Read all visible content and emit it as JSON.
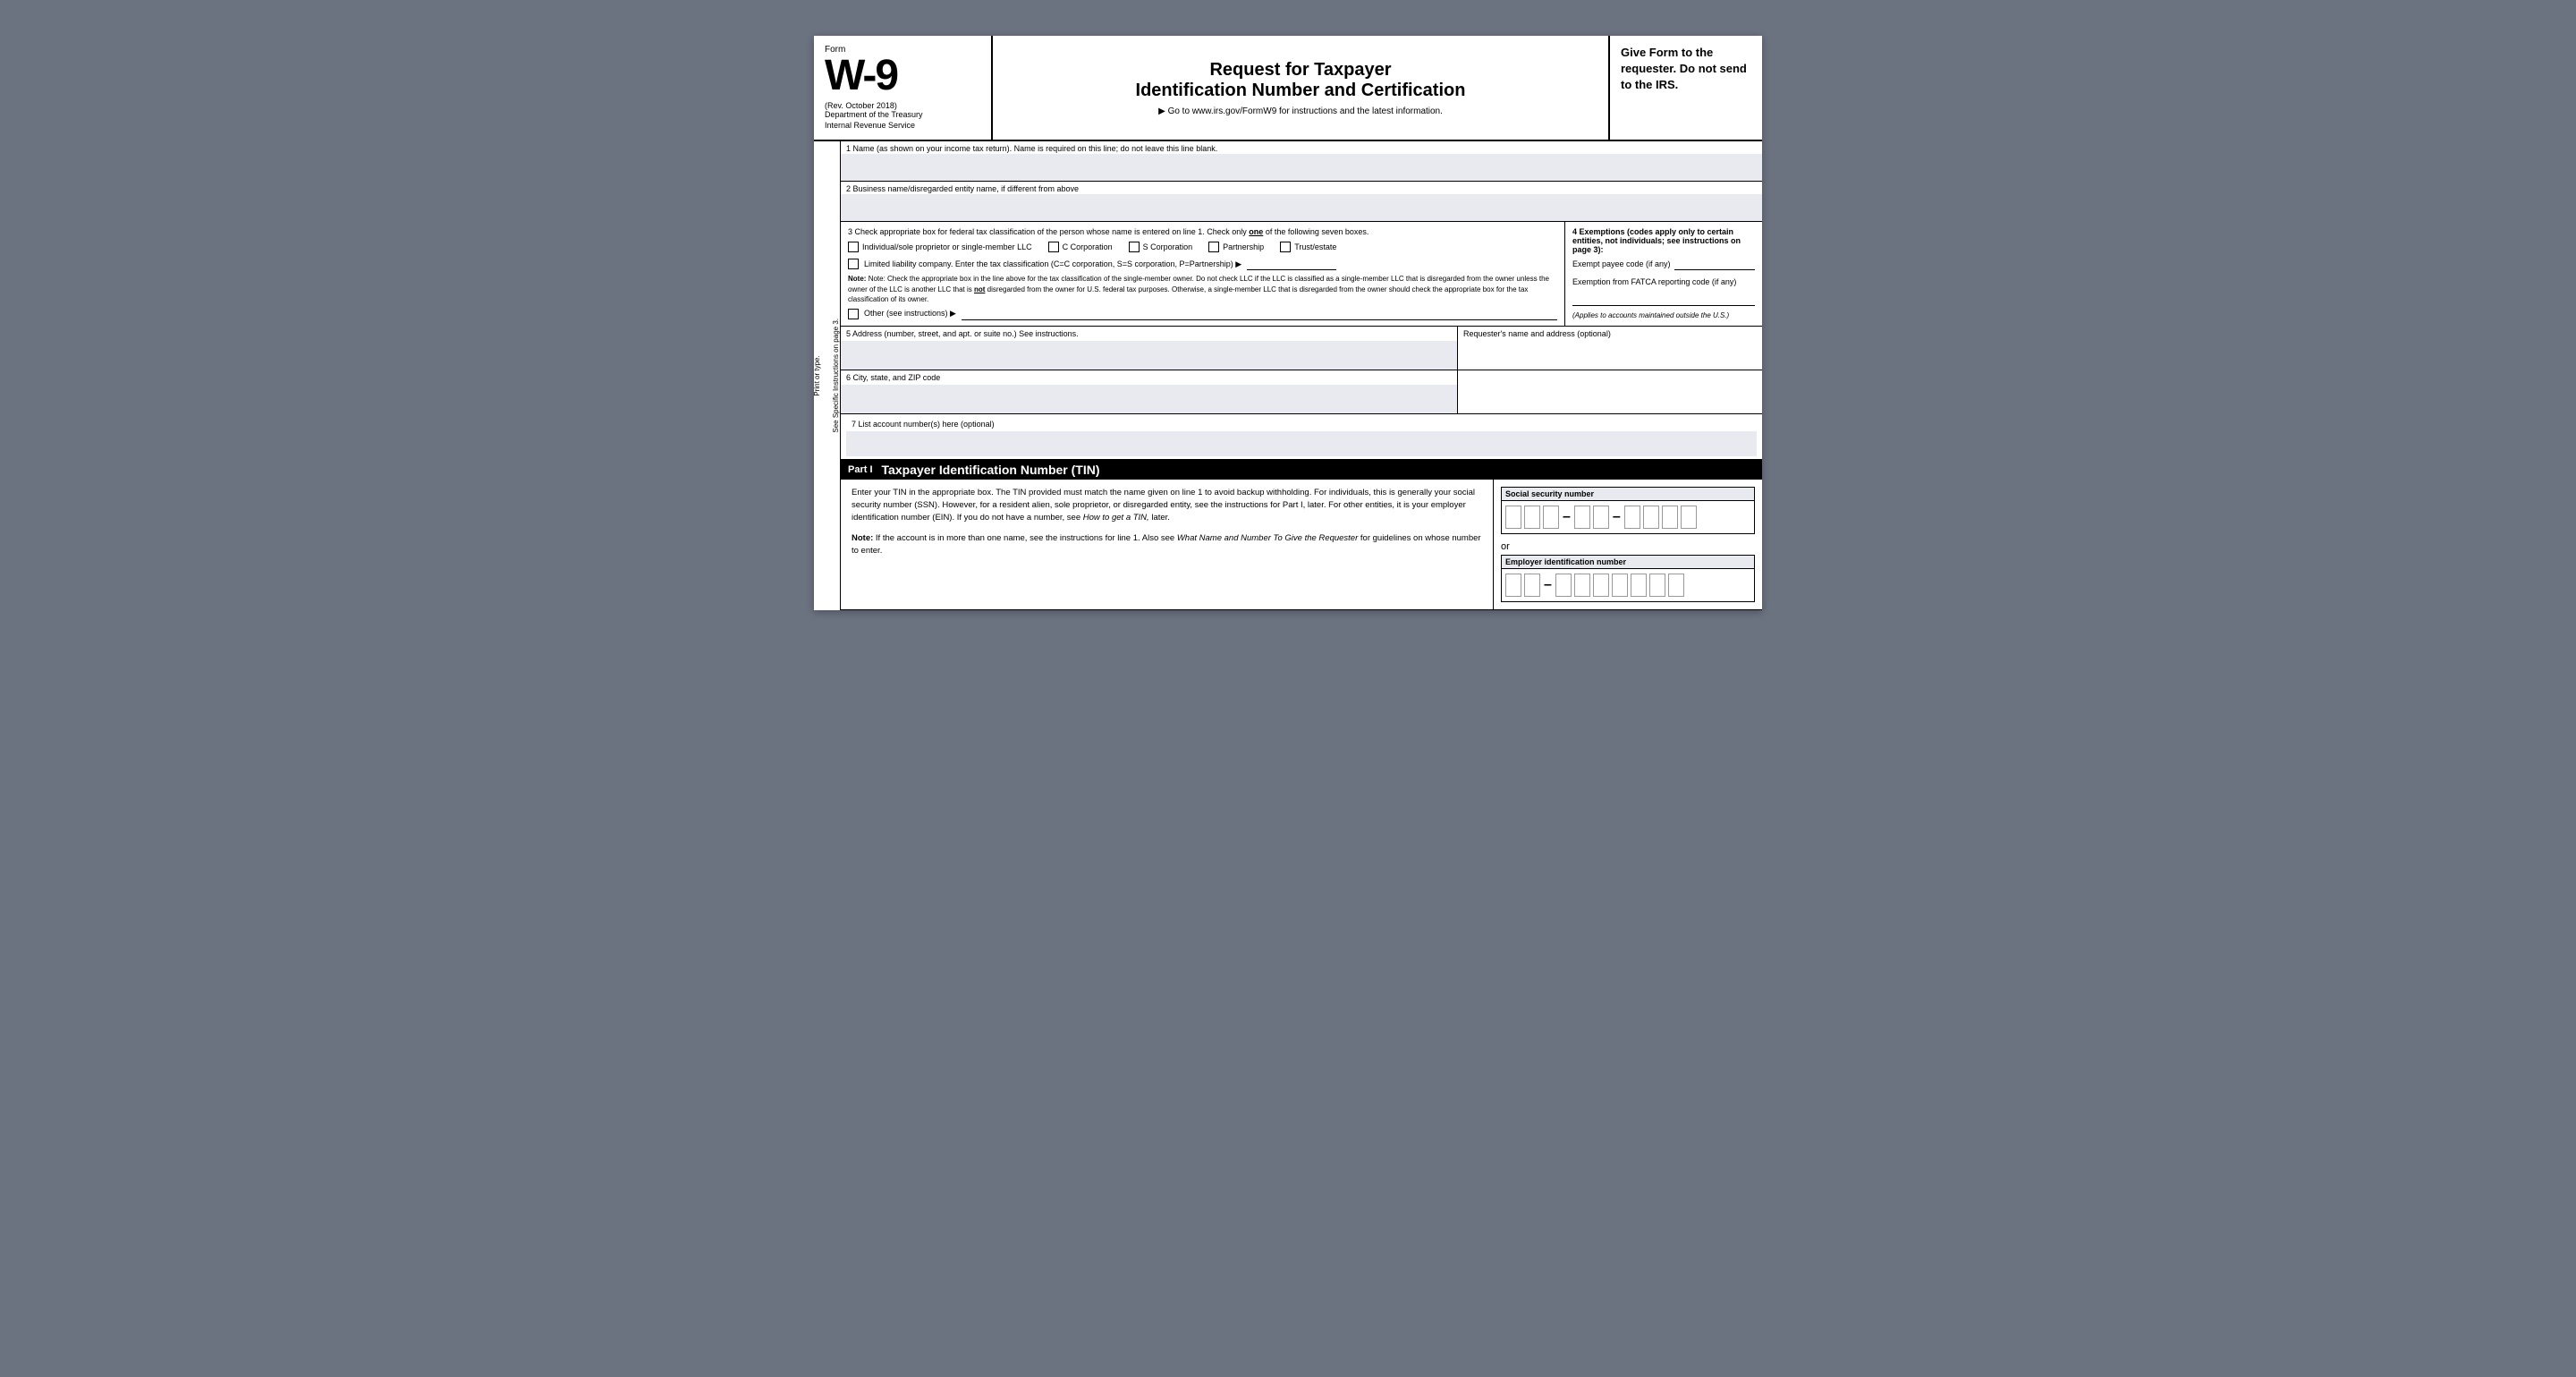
{
  "form": {
    "number": "W-9",
    "label": "Form",
    "rev": "(Rev. October 2018)",
    "dept1": "Department of the Treasury",
    "dept2": "Internal Revenue Service",
    "title1": "Request for Taxpayer",
    "title2": "Identification Number and Certification",
    "goto": "▶ Go to www.irs.gov/FormW9 for instructions and the latest information.",
    "give_form": "Give Form to the requester. Do not send to the IRS."
  },
  "sidebar": {
    "line1": "Print or type.",
    "line2": "See Specific Instructions on page 3."
  },
  "fields": {
    "line1_label": "1  Name (as shown on your income tax return). Name is required on this line; do not leave this line blank.",
    "line2_label": "2  Business name/disregarded entity name, if different from above",
    "line3_label": "3  Check appropriate box for federal tax classification of the person whose name is entered on line 1. Check only",
    "line3_label_one": "one",
    "line3_label_end": "of the following seven boxes.",
    "cb_individual": "Individual/sole proprietor or single-member LLC",
    "cb_c_corp": "C Corporation",
    "cb_s_corp": "S Corporation",
    "cb_partnership": "Partnership",
    "cb_trust": "Trust/estate",
    "cb_llc_label": "Limited liability company. Enter the tax classification (C=C corporation, S=S corporation, P=Partnership) ▶",
    "llc_note": "Note: Check the appropriate box in the line above for the tax classification of the single-member owner.  Do not check LLC if the LLC is classified as a single-member LLC that is disregarded from the owner unless the owner of the LLC is another LLC that is",
    "not_text": "not",
    "llc_note2": "disregarded from the owner for U.S. federal tax purposes. Otherwise, a single-member LLC that is disregarded from the owner should check the appropriate box for the tax classification of its owner.",
    "cb_other": "Other (see instructions) ▶",
    "exemptions_title": "4  Exemptions (codes apply only to certain entities, not individuals; see instructions on page 3):",
    "exempt_payee_label": "Exempt payee code (if any)",
    "fatca_label": "Exemption from FATCA reporting code (if any)",
    "fatca_note": "(Applies to accounts maintained outside the U.S.)",
    "line5_label": "5  Address (number, street, and apt. or suite no.) See instructions.",
    "requester_label": "Requester's name and address (optional)",
    "line6_label": "6  City, state, and ZIP code",
    "line7_label": "7  List account number(s) here (optional)"
  },
  "part1": {
    "badge": "Part I",
    "title": "Taxpayer Identification Number (TIN)",
    "body1": "Enter your TIN in the appropriate box. The TIN provided must match the name given on line 1 to avoid backup withholding. For individuals, this is generally your social security number (SSN). However, for a resident alien, sole proprietor, or disregarded entity, see the instructions for Part I, later. For other entities, it is your employer identification number (EIN). If you do not have a number, see",
    "how_to": "How to get a TIN,",
    "body2": "later.",
    "note_label": "Note:",
    "note_body": "If the account is in more than one name, see the instructions for line 1. Also see",
    "what_name": "What Name and Number To Give the Requester",
    "note_end": "for guidelines on whose number to enter.",
    "ssn_label": "Social security number",
    "or_text": "or",
    "ein_label": "Employer identification number"
  }
}
